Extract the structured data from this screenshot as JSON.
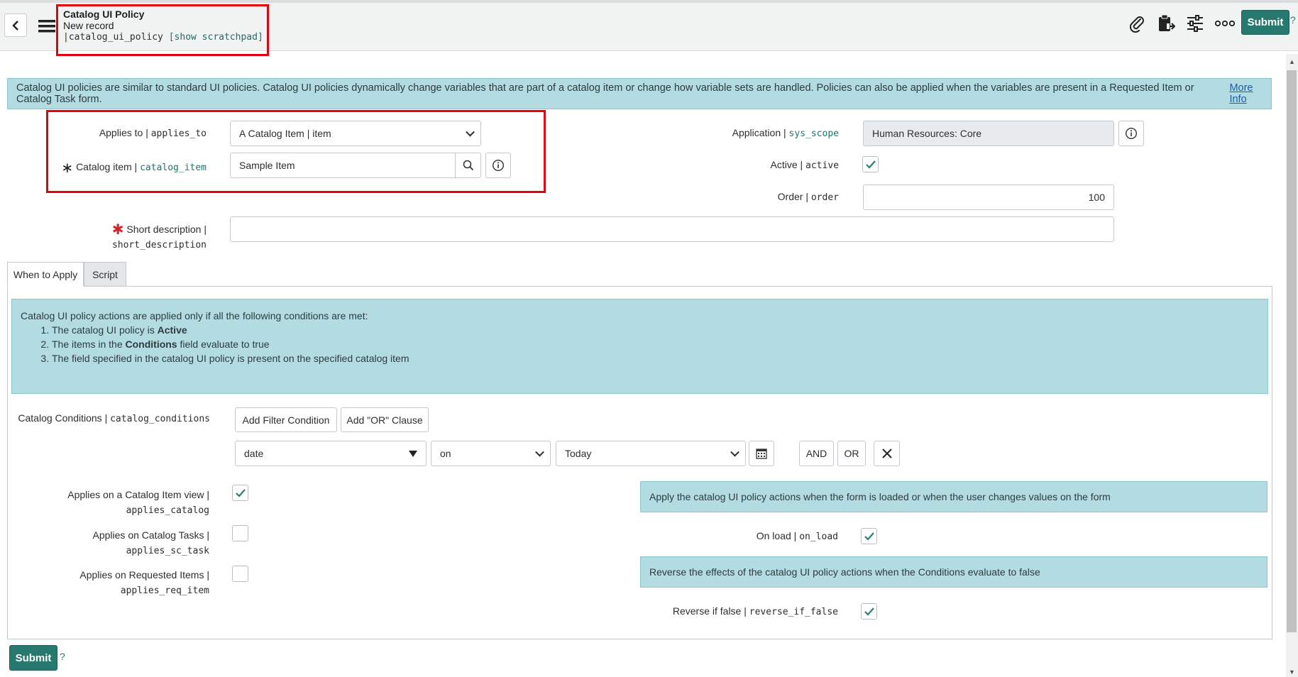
{
  "header": {
    "title": "Catalog UI Policy",
    "subtitle": "New record",
    "table_prefix": "|",
    "table_name": "catalog_ui_policy",
    "scratchpad_link": "[show scratchpad]",
    "submit_label": "Submit",
    "help_mark": "?",
    "icons": [
      "back-icon",
      "menu-icon",
      "paperclip-icon",
      "clipboard-icon",
      "settings-sliders-icon",
      "more-icon"
    ]
  },
  "info_banner": {
    "text": "Catalog UI policies are similar to standard UI policies. Catalog UI policies dynamically change variables that are part of a catalog item or change how variable sets are handled. Policies can also be applied when the variables are present in a Requested Item or Catalog Task form.",
    "link": "More Info"
  },
  "form": {
    "applies_to": {
      "label": "Applies to",
      "sep": "|",
      "name": "applies_to",
      "value": "A Catalog Item | item"
    },
    "catalog_item": {
      "required_mark": "∗",
      "label": "Catalog item",
      "sep": "|",
      "name": "catalog_item",
      "value": "Sample Item"
    },
    "short_description": {
      "required_mark": "✱",
      "label": "Short description |",
      "name": "short_description",
      "value": ""
    },
    "application": {
      "label": "Application",
      "sep": "|",
      "name": "sys_scope",
      "value": "Human Resources: Core"
    },
    "active": {
      "label": "Active",
      "sep": "|",
      "name": "active",
      "checked": true
    },
    "order": {
      "label": "Order",
      "sep": "|",
      "name": "order",
      "value": "100"
    }
  },
  "tabs": [
    {
      "label": "When to Apply",
      "active": true
    },
    {
      "label": "Script",
      "active": false
    }
  ],
  "conditions_banner": {
    "intro": "Catalog UI policy actions are applied only if all the following conditions are met:",
    "items": [
      {
        "pre": "The catalog UI policy is ",
        "bold": "Active",
        "post": ""
      },
      {
        "pre": "The items in the ",
        "bold": "Conditions",
        "post": " field evaluate to true"
      },
      {
        "pre": "The field specified in the catalog UI policy is present on the specified catalog item",
        "bold": "",
        "post": ""
      }
    ]
  },
  "catalog_conditions": {
    "label": "Catalog Conditions",
    "sep": "|",
    "name": "catalog_conditions",
    "add_filter_label": "Add Filter Condition",
    "add_or_label": "Add \"OR\" Clause",
    "field_value": "date",
    "operator_value": "on",
    "date_value": "Today",
    "and_label": "AND",
    "or_label": "OR"
  },
  "applies": {
    "catalog": {
      "label": "Applies on a Catalog Item view |",
      "name": "applies_catalog",
      "checked": true
    },
    "sc_task": {
      "label": "Applies on Catalog Tasks |",
      "name": "applies_sc_task",
      "checked": false
    },
    "req_item": {
      "label": "Applies on Requested Items |",
      "name": "applies_req_item",
      "checked": false
    }
  },
  "on_load": {
    "hint": "Apply the catalog UI policy actions when the form is loaded or when the user changes values on the form",
    "label": "On load",
    "sep": "|",
    "name": "on_load",
    "checked": true
  },
  "reverse": {
    "hint": "Reverse the effects of the catalog UI policy actions when the Conditions evaluate to false",
    "label": "Reverse if false",
    "sep": "|",
    "name": "reverse_if_false",
    "checked": true
  },
  "footer": {
    "submit_label": "Submit",
    "help_mark": "?"
  },
  "colors": {
    "accent": "#27796f",
    "banner": "#b2dce1",
    "highlight_border": "#e3010e",
    "link": "#1b7670"
  }
}
